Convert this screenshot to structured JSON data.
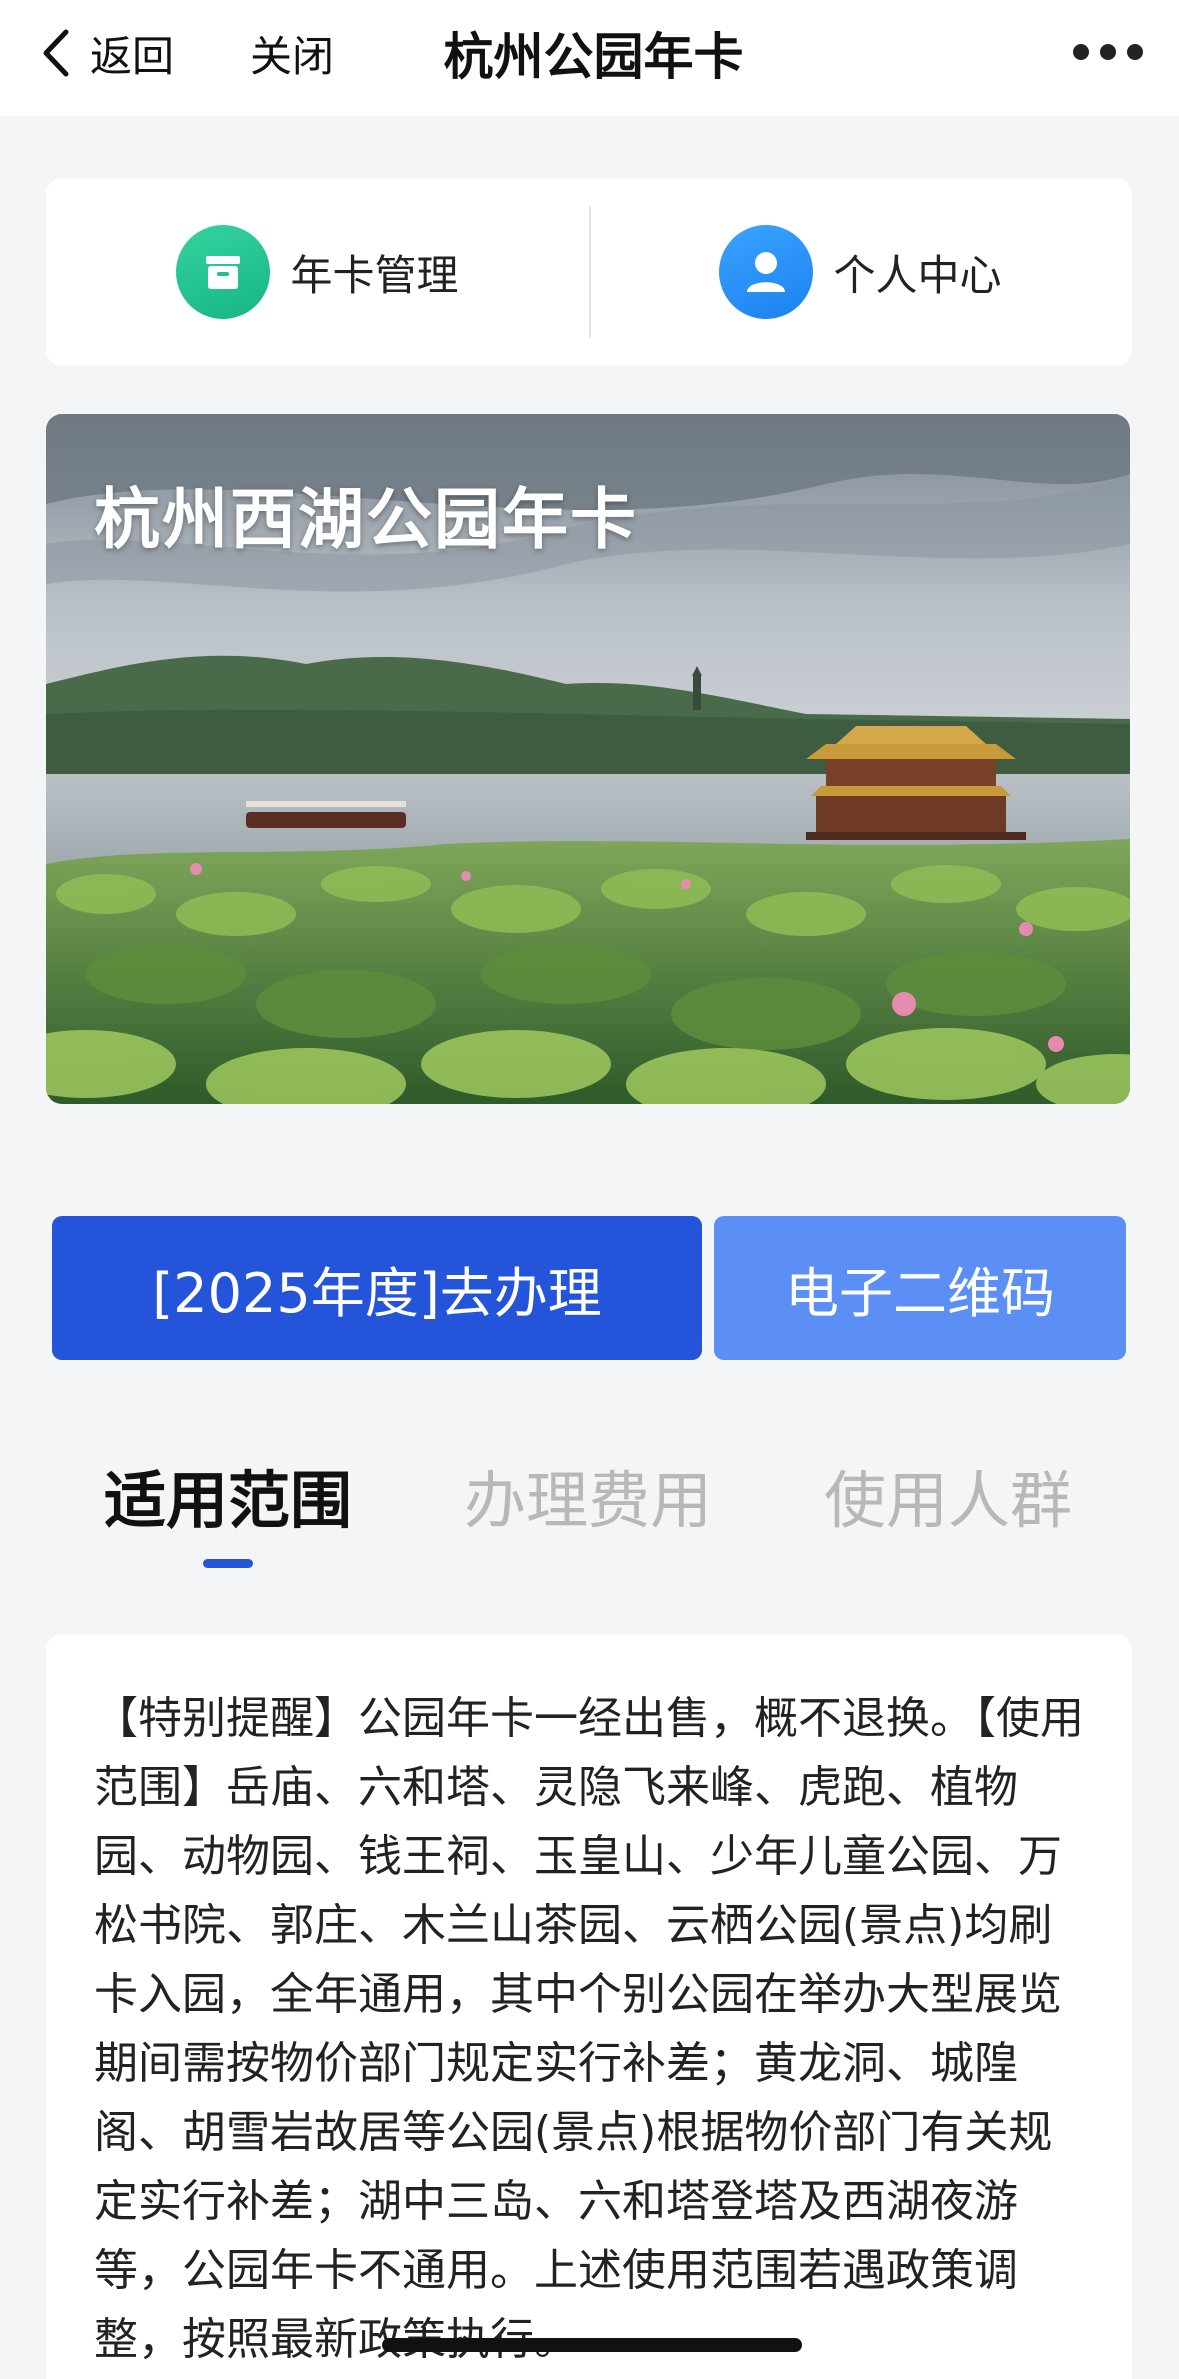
{
  "nav": {
    "back_label": "返回",
    "close_label": "关闭",
    "title": "杭州公园年卡"
  },
  "quick_links": [
    {
      "label": "年卡管理",
      "icon": "card-box-icon",
      "color": "#1fc08f"
    },
    {
      "label": "个人中心",
      "icon": "user-icon",
      "color": "#2b93fa"
    }
  ],
  "banner": {
    "title": "杭州西湖公园年卡"
  },
  "actions": {
    "apply_label": "[2025年度]去办理",
    "qrcode_label": "电子二维码",
    "apply_color": "#2354d9",
    "qrcode_color": "#5b8ff5"
  },
  "tabs": [
    {
      "label": "适用范围",
      "active": true
    },
    {
      "label": "办理费用",
      "active": false
    },
    {
      "label": "使用人群",
      "active": false
    }
  ],
  "info": {
    "text": "【特别提醒】公园年卡一经出售，概不退换。【使用范围】岳庙、六和塔、灵隐飞来峰、虎跑、植物园、动物园、钱王祠、玉皇山、少年儿童公园、万松书院、郭庄、木兰山茶园、云栖公园(景点)均刷卡入园，全年通用，其中个别公园在举办大型展览期间需按物价部门规定实行补差；黄龙洞、城隍阁、胡雪岩故居等公园(景点)根据物价部门有关规定实行补差；湖中三岛、六和塔登塔及西湖夜游等，公园年卡不通用。上述使用范围若遇政策调整，按照最新政策执行。"
  }
}
